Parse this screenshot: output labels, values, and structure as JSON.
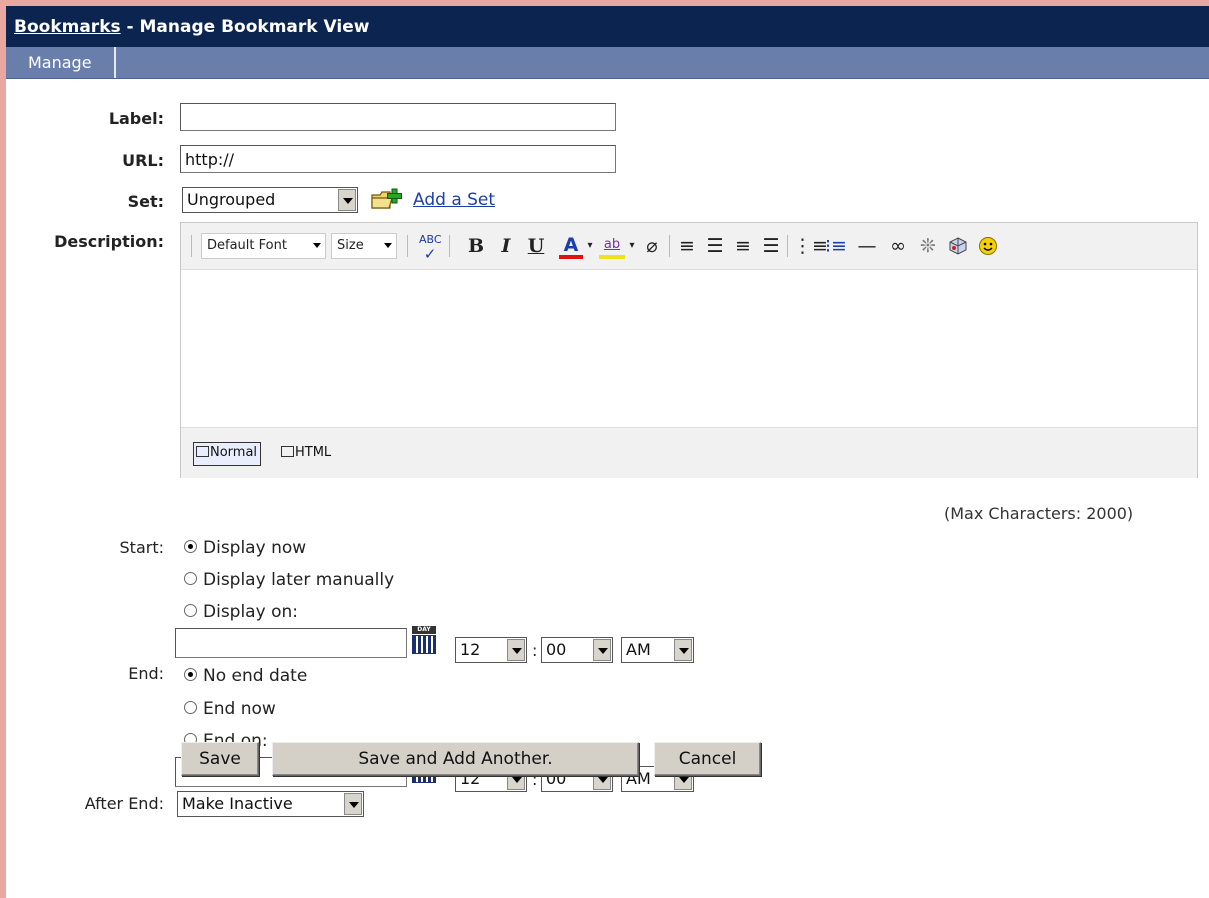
{
  "header": {
    "breadcrumb_link": "Bookmarks",
    "title_rest": " - Manage Bookmark View"
  },
  "tabs": {
    "manage": "Manage"
  },
  "form": {
    "label": {
      "caption": "Label:",
      "value": ""
    },
    "url": {
      "caption": "URL:",
      "value": "http://"
    },
    "set": {
      "caption": "Set:",
      "selected": "Ungrouped",
      "add_link": "Add a Set"
    },
    "description": {
      "caption": "Description:"
    }
  },
  "editor": {
    "font_label": "Default Font",
    "size_label": "Size",
    "toolbar_icons": [
      "spellcheck-icon",
      "bold-icon",
      "italic-icon",
      "underline-icon",
      "font-color-icon",
      "highlight-icon",
      "eraser-icon",
      "align-left-icon",
      "align-center-icon",
      "align-right-icon",
      "justify-icon",
      "ordered-list-icon",
      "unordered-list-icon",
      "horizontal-rule-icon",
      "link-icon",
      "unlink-icon",
      "insert-object-icon",
      "smiley-icon"
    ],
    "bold": "B",
    "italic": "I",
    "underline": "U",
    "font_color": "A",
    "highlight": "ab",
    "mode_normal": "Normal",
    "mode_html": "HTML"
  },
  "max_chars": "(Max Characters: 2000)",
  "start": {
    "caption": "Start:",
    "options": [
      "Display now",
      "Display later manually",
      "Display on:"
    ],
    "selected_index": 0,
    "date_value": "",
    "hour": "12",
    "minute": "00",
    "ampm": "AM"
  },
  "end": {
    "caption": "End:",
    "options": [
      "No end date",
      "End now",
      "End on:"
    ],
    "selected_index": 0,
    "date_value": "",
    "hour": "12",
    "minute": "00",
    "ampm": "AM"
  },
  "after_end": {
    "caption": "After End:",
    "selected": "Make Inactive"
  },
  "time_separator": ":",
  "calendar_label": "DAY",
  "buttons": {
    "save": "Save",
    "save_add": "Save and Add Another.",
    "cancel": "Cancel"
  },
  "colors": {
    "titlebar": "#0b2450",
    "tabbar": "#6a7eab",
    "link": "#1a3fa8",
    "frame": "#e9a7a2"
  }
}
